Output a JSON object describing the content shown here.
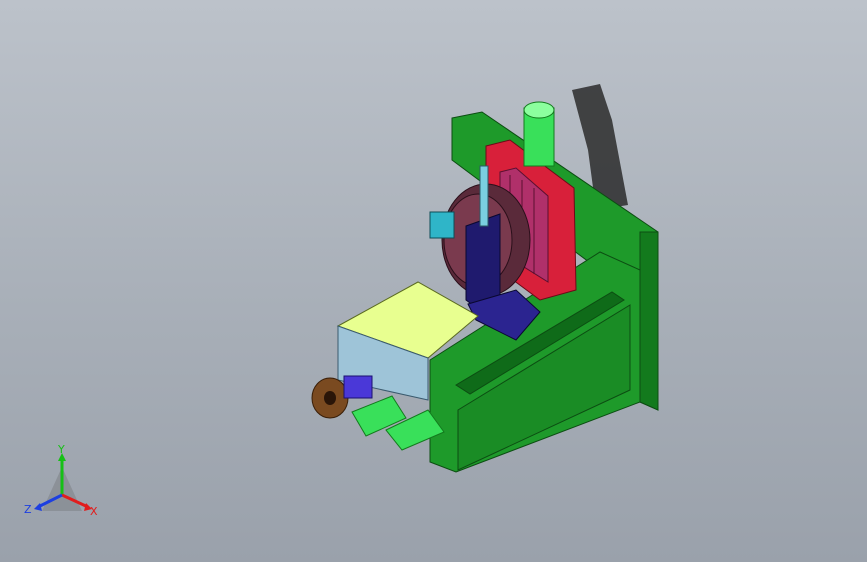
{
  "viewport": {
    "background_top": "#bcc2ca",
    "background_bottom": "#9aa1ab"
  },
  "triad": {
    "x_label": "X",
    "y_label": "Y",
    "z_label": "Z",
    "x_color": "#e11d1d",
    "y_color": "#16c016",
    "z_color": "#1d3fe1"
  },
  "model": {
    "colors": {
      "base_plate": "#1e9a2a",
      "base_plate_dark": "#137a1d",
      "red_slide": "#d8203a",
      "magenta_rails": "#b0306a",
      "cylinder": "#39e05a",
      "motor_block": "#e8ff90",
      "motor_side": "#9ec4d8",
      "bracket": "#1f1a6e",
      "disc": "#5a2a3a"
    }
  }
}
